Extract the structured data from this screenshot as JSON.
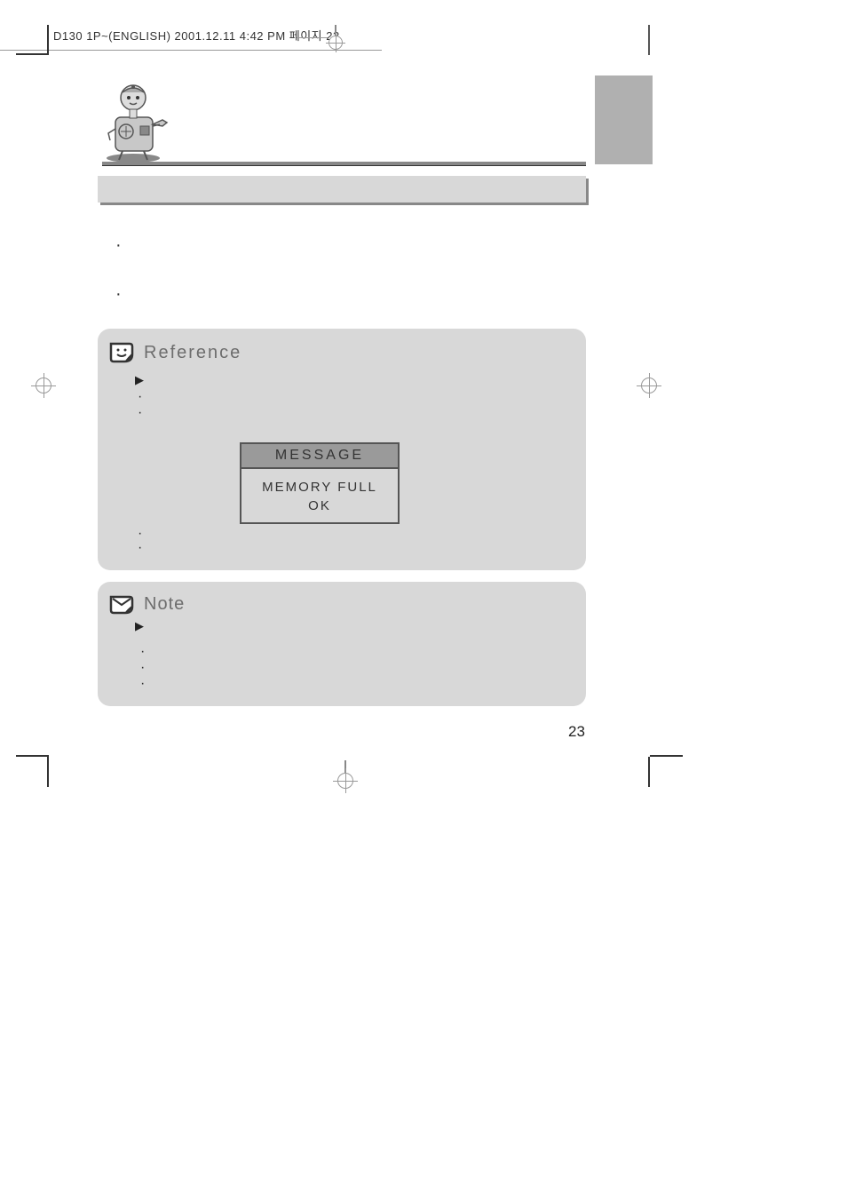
{
  "header_text": "D130 1P~(ENGLISH)  2001.12.11  4:42 PM  페이지 23",
  "reference": {
    "title": "Reference",
    "message_header": "MESSAGE",
    "message_line1": "MEMORY FULL",
    "message_line2": "OK"
  },
  "note": {
    "title": "Note"
  },
  "page_number": "23"
}
